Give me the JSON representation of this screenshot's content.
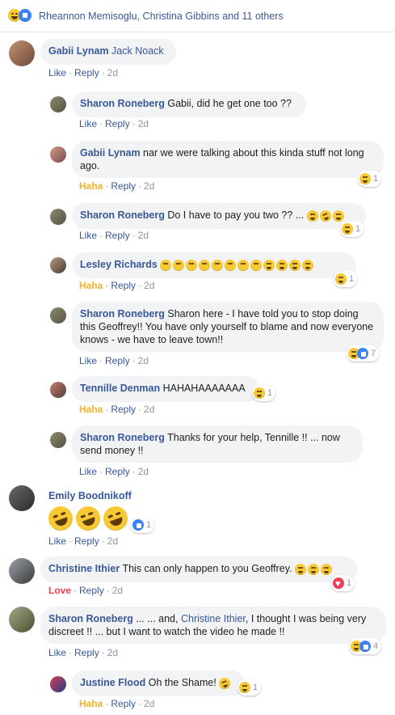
{
  "top_reactions": {
    "icons": [
      "haha-emoji",
      "like-icon"
    ],
    "text": "Rheannon Memisoglu, Christina Gibbins and 11 others"
  },
  "actions": {
    "like": "Like",
    "reply": "Reply",
    "haha": "Haha",
    "love": "Love",
    "dot": "·"
  },
  "comments": [
    {
      "name": "Gabii Lynam",
      "text": "Jack Noack",
      "time": "2d",
      "reaction": "Like"
    },
    {
      "name": "Sharon Roneberg",
      "text": "Gabii, did he get one too ??",
      "time": "2d",
      "reaction": "Like"
    },
    {
      "name": "Gabii Lynam",
      "text": "nar we were talking about this kinda stuff not long ago.",
      "time": "2d",
      "reaction": "Haha",
      "count": "1"
    },
    {
      "name": "Sharon Roneberg",
      "text": "Do I have to pay you two ?? ...",
      "time": "2d",
      "reaction": "Like",
      "count": "1"
    },
    {
      "name": "Lesley Richards",
      "text": "",
      "time": "2d",
      "reaction": "Haha",
      "count": "1"
    },
    {
      "name": "Sharon Roneberg",
      "text": "Sharon here - I have told you to stop doing this Geoffrey!! You have only yourself to blame and now everyone knows - we have to leave town!!",
      "time": "2d",
      "reaction": "Like",
      "count": "7"
    },
    {
      "name": "Tennille Denman",
      "text": "HAHAHAAAAAAA",
      "time": "2d",
      "reaction": "Haha",
      "count": "1"
    },
    {
      "name": "Sharon Roneberg",
      "text": "Thanks for your help, Tennille !! ... now send money !!",
      "time": "2d",
      "reaction": "Like"
    },
    {
      "name": "Emily Boodnikoff",
      "text": "",
      "time": "2d",
      "reaction": "Like",
      "count": "1"
    },
    {
      "name": "Christine Ithier",
      "text": "This can only happen to you Geoffrey.",
      "time": "2d",
      "reaction": "Love",
      "count": "1"
    },
    {
      "name": "Sharon Roneberg",
      "text_a": "... ... and,",
      "tagged": "Christine Ithier",
      "text_b": ", I thought I was being very discreet !! ... but I want to watch the video he made !!",
      "time": "2d",
      "reaction": "Like",
      "count": "4"
    },
    {
      "name": "Justine Flood",
      "text": "Oh the Shame!",
      "time": "2d",
      "reaction": "Haha",
      "count": "1"
    }
  ],
  "colors": {
    "link": "#385898",
    "bubble": "#f2f3f5",
    "haha": "#f7b125",
    "love": "#f33e58",
    "like_blue": "#3b82f6"
  }
}
